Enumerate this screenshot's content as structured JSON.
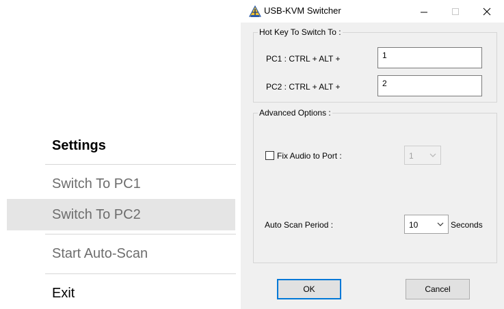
{
  "menu": {
    "items": [
      {
        "label": "Settings"
      },
      {
        "label": "Switch To PC1"
      },
      {
        "label": "Switch To PC2"
      },
      {
        "label": "Start Auto-Scan"
      },
      {
        "label": "Exit"
      }
    ]
  },
  "dialog": {
    "title": "USB-KVM Switcher",
    "hotkey_group": {
      "legend": "Hot Key To Switch To :",
      "pc1_label": "PC1 : CTRL + ALT +",
      "pc1_value": "1",
      "pc2_label": "PC2 : CTRL + ALT +",
      "pc2_value": "2"
    },
    "advanced_group": {
      "legend": "Advanced Options :",
      "fix_audio_label": "Fix Audio to Port :",
      "fix_audio_checked": false,
      "fix_audio_port": "1",
      "auto_scan_label": "Auto Scan Period :",
      "auto_scan_value": "10",
      "auto_scan_unit": "Seconds"
    },
    "buttons": {
      "ok": "OK",
      "cancel": "Cancel"
    }
  },
  "colors": {
    "accent": "#0078d7",
    "dialog_bg": "#f0f0f0",
    "menu_hover": "#e5e5e5"
  }
}
